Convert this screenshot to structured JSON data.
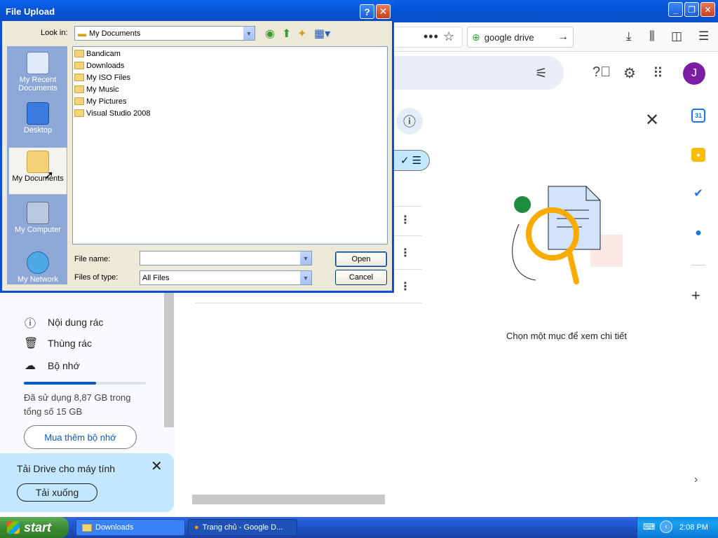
{
  "firefox": {
    "url_overflow_icon": "more-dots-icon",
    "bookmark_icon": "star-icon",
    "search_text": "google drive",
    "toolbar_icons": [
      "download-icon",
      "library-icon",
      "sidebar-icon",
      "menu-icon"
    ]
  },
  "drive": {
    "avatar_initial": "J",
    "detail_text": "Chọn một mục để xem chi tiết",
    "sidebar": [
      {
        "icon": "spam-icon",
        "label": "Nội dung rác"
      },
      {
        "icon": "trash-icon",
        "label": "Thùng rác"
      },
      {
        "icon": "cloud-icon",
        "label": "Bộ nhớ"
      }
    ],
    "storage_fraction": 0.59,
    "storage_text": "Đã sử dụng 8,87 GB trong tổng số 15 GB",
    "buy_storage": "Mua thêm bộ nhớ",
    "promo_title": "Tải Drive cho máy tính",
    "promo_button": "Tải xuống"
  },
  "dialog": {
    "title": "File Upload",
    "look_in_label": "Look in:",
    "look_in_value": "My Documents",
    "places": [
      "My Recent Documents",
      "Desktop",
      "My Documents",
      "My Computer",
      "My Network"
    ],
    "files": [
      "Bandicam",
      "Downloads",
      "My ISO Files",
      "My Music",
      "My Pictures",
      "Visual Studio 2008"
    ],
    "file_name_label": "File name:",
    "file_name_value": "",
    "file_type_label": "Files of type:",
    "file_type_value": "All Files",
    "open_button": "Open",
    "cancel_button": "Cancel"
  },
  "taskbar": {
    "start": "start",
    "tasks": [
      "Downloads",
      "Trang chủ - Google D..."
    ],
    "clock": "2:08 PM"
  }
}
